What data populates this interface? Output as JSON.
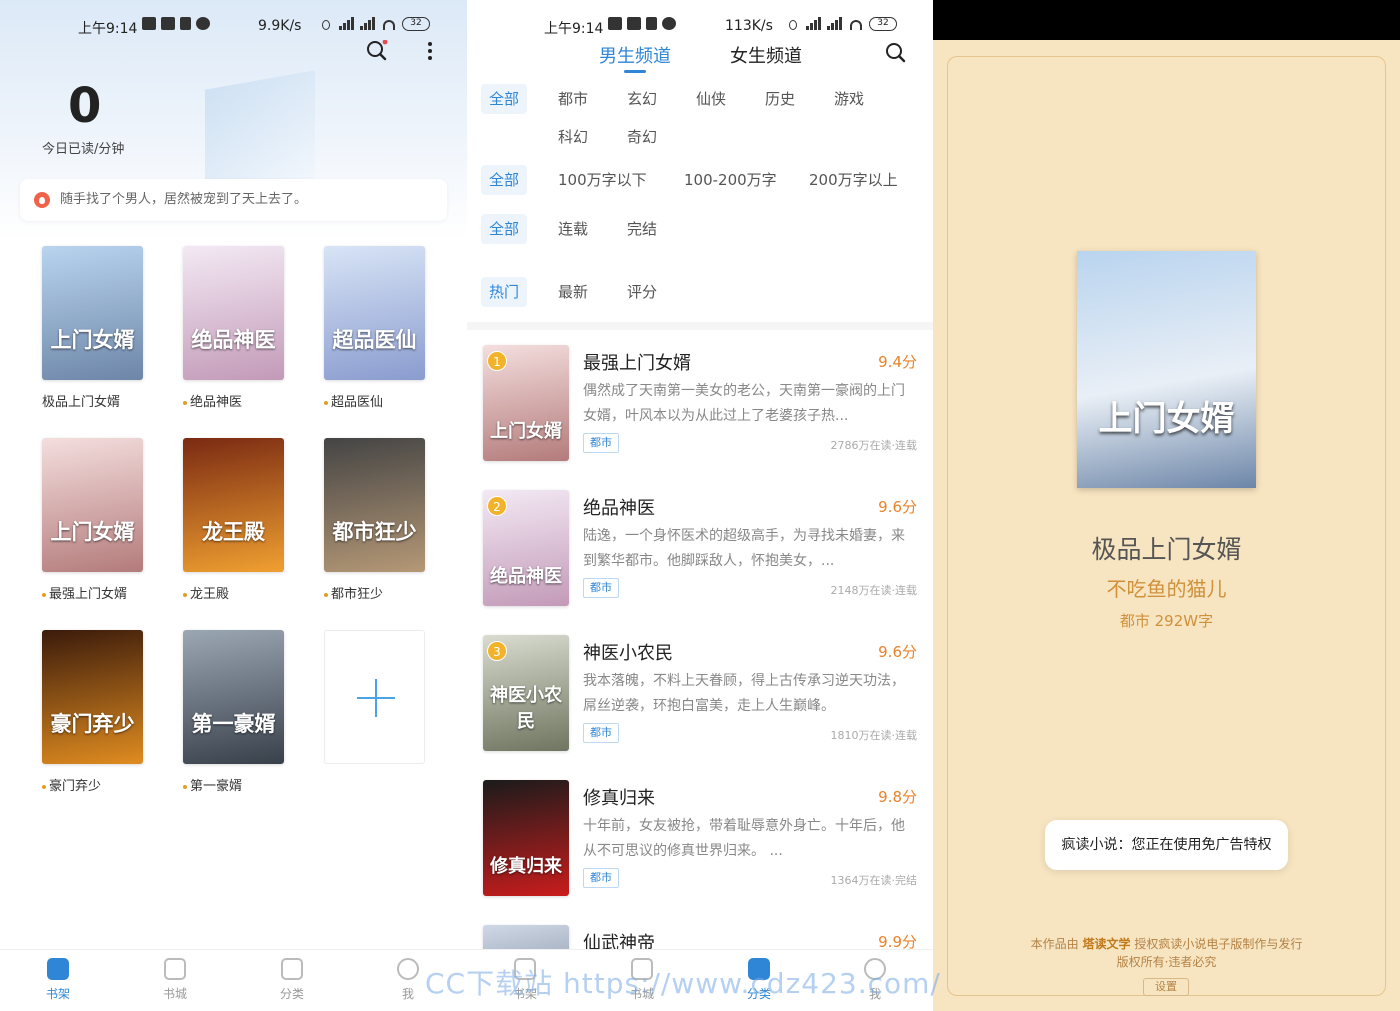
{
  "status_left": {
    "time": "上午9:14",
    "speed": "9.9K/s",
    "battery": "32"
  },
  "status_mid": {
    "time": "上午9:14",
    "speed": "113K/s",
    "battery": "32"
  },
  "shelf_page": {
    "read_count": "0",
    "read_label": "今日已读/分钟",
    "notice": "随手找了个男人，居然被宠到了天上去了。",
    "books": [
      {
        "title": "极品上门女婿",
        "cover_text": "上门女婿",
        "dot": false,
        "color1": "#b9d4ef",
        "color2": "#6d86a8"
      },
      {
        "title": "绝品神医",
        "cover_text": "绝品神医",
        "dot": true,
        "color1": "#f3e9f4",
        "color2": "#c39ab8"
      },
      {
        "title": "超品医仙",
        "cover_text": "超品医仙",
        "dot": true,
        "color1": "#d8e4f6",
        "color2": "#8a9ccf"
      },
      {
        "title": "最强上门女婿",
        "cover_text": "上门女婿",
        "dot": true,
        "color1": "#f4dede",
        "color2": "#b47b7b"
      },
      {
        "title": "龙王殿",
        "cover_text": "龙王殿",
        "dot": true,
        "color1": "#7a2a12",
        "color2": "#f0a030"
      },
      {
        "title": "都市狂少",
        "cover_text": "都市狂少",
        "dot": true,
        "color1": "#444444",
        "color2": "#b59876"
      },
      {
        "title": "豪门弃少",
        "cover_text": "豪门弃少",
        "dot": true,
        "color1": "#3b1b0b",
        "color2": "#e08c20"
      },
      {
        "title": "第一豪婿",
        "cover_text": "第一豪婿",
        "dot": true,
        "color1": "#9ca7b4",
        "color2": "#38404a"
      }
    ]
  },
  "nav_left": [
    {
      "label": "书架",
      "active": true
    },
    {
      "label": "书城",
      "active": false
    },
    {
      "label": "分类",
      "active": false
    },
    {
      "label": "我",
      "active": false
    }
  ],
  "nav_mid": [
    {
      "label": "书架",
      "active": false
    },
    {
      "label": "书城",
      "active": false
    },
    {
      "label": "分类",
      "active": true
    },
    {
      "label": "我",
      "active": false
    }
  ],
  "category_page": {
    "tabs": [
      "男生频道",
      "女生频道"
    ],
    "genre_row1": [
      "全部",
      "都市",
      "玄幻",
      "仙侠",
      "历史",
      "游戏"
    ],
    "genre_row2": [
      "科幻",
      "奇幻"
    ],
    "length_row": [
      "全部",
      "100万字以下",
      "100-200万字",
      "200万字以上"
    ],
    "status_row": [
      "全部",
      "连载",
      "完结"
    ],
    "sort_row": [
      "热门",
      "最新",
      "评分"
    ],
    "books": [
      {
        "rank": "1",
        "title": "最强上门女婿",
        "score": "9.4分",
        "desc": "偶然成了天南第一美女的老公，天南第一豪阀的上门女婿，叶风本以为从此过上了老婆孩子热...",
        "tag": "都市",
        "meta": "2786万在读·连载",
        "cover_text": "上门女婿",
        "color1": "#f4dede",
        "color2": "#b47b7b"
      },
      {
        "rank": "2",
        "title": "绝品神医",
        "score": "9.6分",
        "desc": "陆逸，一个身怀医术的超级高手，为寻找未婚妻，来到繁华都市。他脚踩敌人，怀抱美女，...",
        "tag": "都市",
        "meta": "2148万在读·连载",
        "cover_text": "绝品神医",
        "color1": "#f3e9f4",
        "color2": "#c39ab8"
      },
      {
        "rank": "3",
        "title": "神医小农民",
        "score": "9.6分",
        "desc": "我本落魄，不料上天眷顾，得上古传承习逆天功法，屌丝逆袭，环抱白富美，走上人生巅峰。",
        "tag": "都市",
        "meta": "1810万在读·连载",
        "cover_text": "神医小农民",
        "color1": "#d9dccf",
        "color2": "#6f7560"
      },
      {
        "rank": "",
        "title": "修真归来",
        "score": "9.8分",
        "desc": "十年前，女友被抢，带着耻辱意外身亡。十年后，他从不可思议的修真世界归来。 ...",
        "tag": "都市",
        "meta": "1364万在读·完结",
        "cover_text": "修真归来",
        "color1": "#1b1b1b",
        "color2": "#c91c1c"
      },
      {
        "rank": "",
        "title": "仙武神帝",
        "score": "9.9分",
        "desc": "",
        "tag": "",
        "meta": "",
        "cover_text": "",
        "color1": "#cfd8e6",
        "color2": "#5a6a80"
      }
    ]
  },
  "reader_page": {
    "cover_text": "上门女婿",
    "title": "极品上门女婿",
    "author": "不吃鱼的猫儿",
    "meta": "都市  292W字",
    "toast": "疯读小说：您正在使用免广告特权",
    "foot_prefix": "本作品由",
    "foot_brand": "塔读文学",
    "foot_suffix": "授权疯读小说电子版制作与发行",
    "foot2": "版权所有·违者必究",
    "settings_btn": "设置"
  },
  "watermark": "CC下载站 https://www.cdz423.com/"
}
